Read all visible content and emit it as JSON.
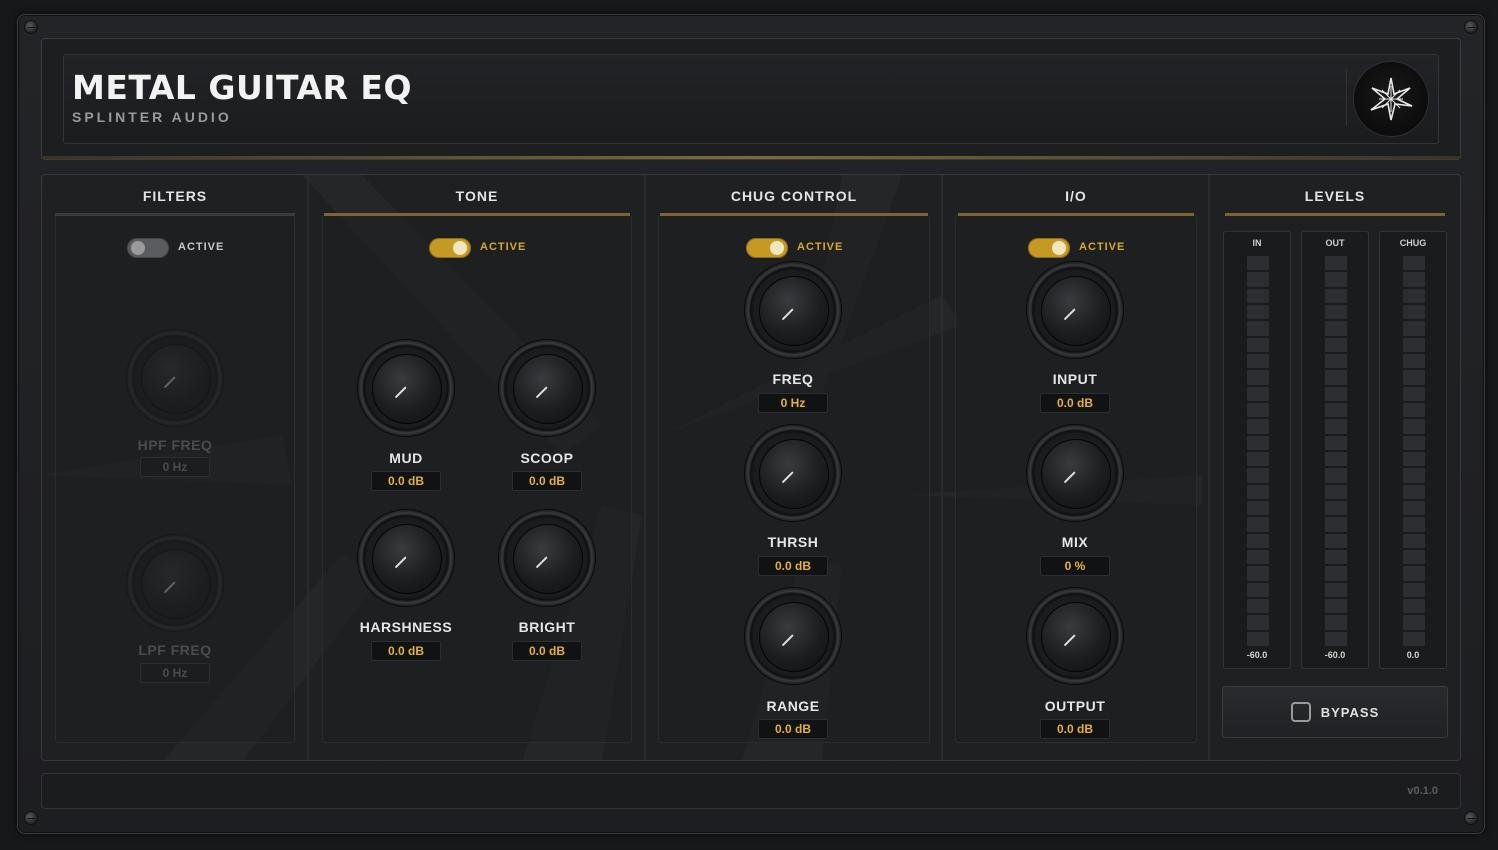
{
  "header": {
    "title": "METAL GUITAR EQ",
    "subtitle": "SPLINTER AUDIO",
    "logo_icon": "shattered-star-logo"
  },
  "colors": {
    "accent": "#c59a22",
    "value_text": "#e5b32e",
    "background": "#17181a"
  },
  "sections": {
    "filters": {
      "title": "FILTERS",
      "toggle": {
        "label": "ACTIVE",
        "on": false
      },
      "knobs": [
        {
          "label": "HPF FREQ",
          "value": "0 Hz"
        },
        {
          "label": "LPF FREQ",
          "value": "0 Hz"
        }
      ]
    },
    "tone": {
      "title": "TONE",
      "toggle": {
        "label": "ACTIVE",
        "on": true
      },
      "knobs": [
        {
          "label": "MUD",
          "value": "0.0 dB"
        },
        {
          "label": "SCOOP",
          "value": "0.0 dB"
        },
        {
          "label": "HARSHNESS",
          "value": "0.0 dB"
        },
        {
          "label": "BRIGHT",
          "value": "0.0 dB"
        }
      ]
    },
    "chug": {
      "title": "CHUG CONTROL",
      "toggle": {
        "label": "ACTIVE",
        "on": true
      },
      "knobs": [
        {
          "label": "FREQ",
          "value": "0 Hz"
        },
        {
          "label": "THRSH",
          "value": "0.0 dB"
        },
        {
          "label": "RANGE",
          "value": "0.0 dB"
        }
      ]
    },
    "io": {
      "title": "I/O",
      "toggle": {
        "label": "ACTIVE",
        "on": true
      },
      "knobs": [
        {
          "label": "INPUT",
          "value": "0.0 dB"
        },
        {
          "label": "MIX",
          "value": "0 %"
        },
        {
          "label": "OUTPUT",
          "value": "0.0 dB"
        }
      ]
    },
    "levels": {
      "title": "LEVELS",
      "meters": [
        {
          "name": "IN",
          "value": "-60.0"
        },
        {
          "name": "OUT",
          "value": "-60.0"
        },
        {
          "name": "CHUG",
          "value": "0.0"
        }
      ],
      "bypass_label": "BYPASS"
    }
  },
  "footer": {
    "version": "v0.1.0"
  }
}
